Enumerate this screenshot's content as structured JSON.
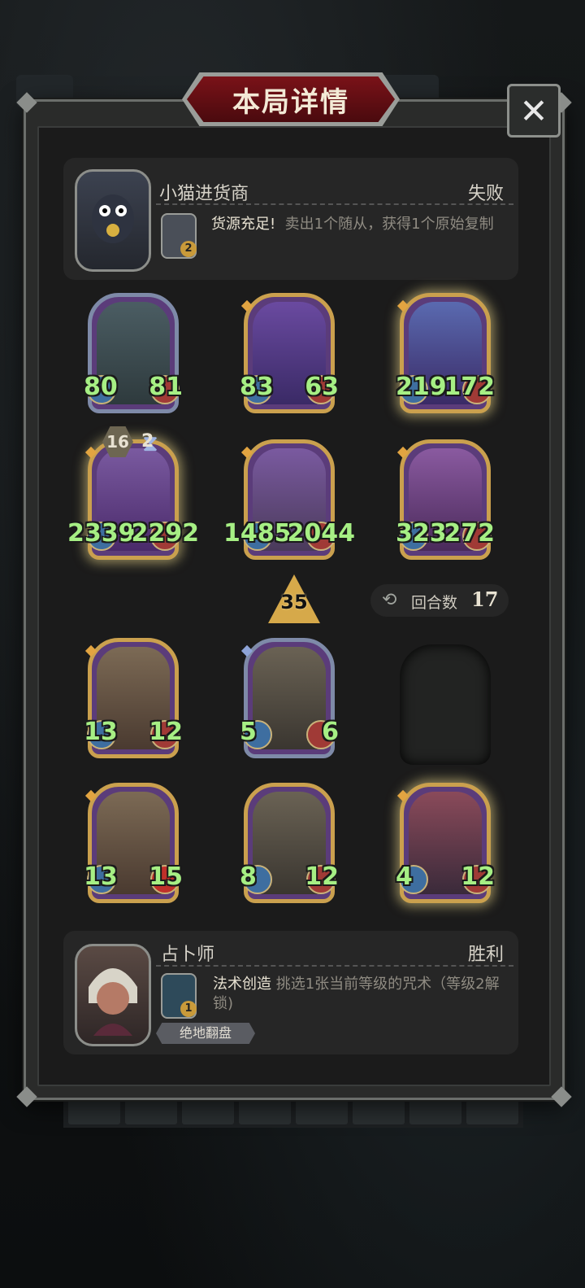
{
  "title": "本局详情",
  "close_label": "✕",
  "opponent": {
    "name": "小猫进货商",
    "result": "失败",
    "skill_level": "2",
    "skill_name": "货源充足!",
    "skill_desc": "卖出1个随从，获得1个原始复制"
  },
  "player": {
    "name": "占卜师",
    "result": "胜利",
    "skill_level": "1",
    "skill_name": "法术创造",
    "skill_desc": "挑选1张当前等级的咒术（等级2解锁)",
    "title_chip": "绝地翻盘"
  },
  "opponent_board": [
    {
      "atk": "80",
      "hp": "81",
      "frame": "silver"
    },
    {
      "atk": "83",
      "hp": "63",
      "frame": "gold"
    },
    {
      "atk": "219",
      "hp": "172",
      "frame": "gold"
    },
    {
      "atk": "2339",
      "hp": "2292",
      "frame": "gold"
    },
    {
      "atk": "1485",
      "hp": "2044",
      "frame": "gold"
    },
    {
      "atk": "323",
      "hp": "272",
      "frame": "gold"
    }
  ],
  "minion_badge": {
    "value": "16",
    "hourglass": "2"
  },
  "tavern_tier": "35",
  "round": {
    "label": "回合数",
    "value": "17"
  },
  "player_board": [
    {
      "atk": "13",
      "hp": "12",
      "frame": "gold"
    },
    {
      "atk": "5",
      "hp": "6",
      "frame": "silver"
    },
    {
      "atk": "13",
      "hp": "15",
      "frame": "gold"
    },
    {
      "atk": "8",
      "hp": "12",
      "frame": "gold"
    },
    {
      "atk": "4",
      "hp": "12",
      "frame": "gold"
    }
  ],
  "colors": {
    "gold_frame": "#caa04e",
    "silver_frame": "#7e8aa8",
    "stat_green": "#a6ef84",
    "banner_red": "#7a1218"
  }
}
